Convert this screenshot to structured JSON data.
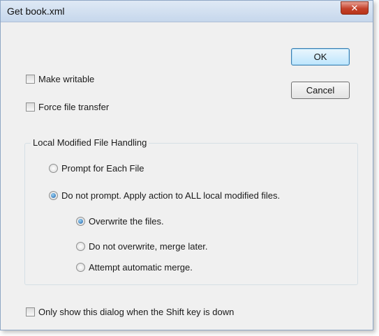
{
  "window": {
    "title": "Get book.xml",
    "close_label": "✕"
  },
  "buttons": {
    "ok_label": "OK",
    "cancel_label": "Cancel"
  },
  "options": {
    "make_writable": {
      "label": "Make writable",
      "checked": false
    },
    "force_file_transfer": {
      "label": "Force file transfer",
      "checked": false
    }
  },
  "group": {
    "title": "Local Modified File Handling",
    "prompt_each": {
      "label": "Prompt for Each File",
      "checked": false
    },
    "do_not_prompt": {
      "label": "Do not prompt.  Apply action to ALL local modified files.",
      "checked": true
    },
    "overwrite": {
      "label": "Overwrite the files.",
      "checked": true
    },
    "no_overwrite": {
      "label": "Do not overwrite, merge later.",
      "checked": false
    },
    "auto_merge": {
      "label": "Attempt automatic merge.",
      "checked": false
    }
  },
  "footer": {
    "shift_only": {
      "label": "Only show this dialog when the Shift key is down",
      "checked": false
    }
  }
}
